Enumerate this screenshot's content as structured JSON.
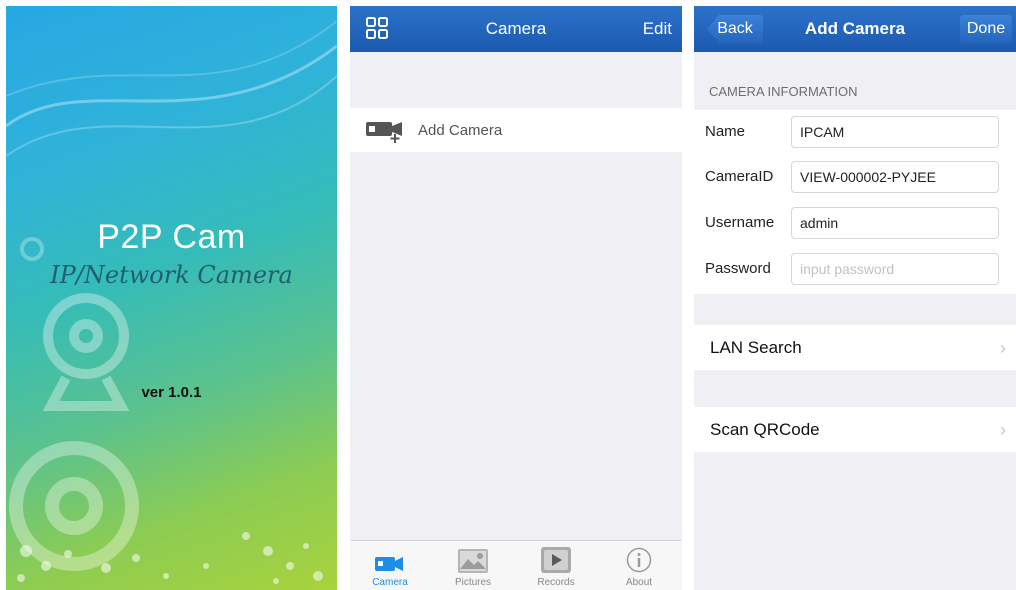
{
  "splash": {
    "title": "P2P Cam",
    "subtitle": "IP/Network Camera",
    "version": "ver 1.0.1"
  },
  "camera_list": {
    "nav_title": "Camera",
    "nav_right": "Edit",
    "menu_icon": "grid-icon",
    "add_camera_label": "Add Camera",
    "add_camera_icon": "camera-add-icon",
    "tabs": [
      {
        "label": "Camera",
        "icon": "camera-icon",
        "active": true
      },
      {
        "label": "Pictures",
        "icon": "pictures-icon",
        "active": false
      },
      {
        "label": "Records",
        "icon": "records-icon",
        "active": false
      },
      {
        "label": "About",
        "icon": "info-icon",
        "active": false
      }
    ]
  },
  "add_camera": {
    "back_label": "Back",
    "title": "Add Camera",
    "done_label": "Done",
    "section_header": "CAMERA INFORMATION",
    "fields": [
      {
        "label": "Name",
        "value": "IPCAM",
        "placeholder": ""
      },
      {
        "label": "CameraID",
        "value": "VIEW-000002-PYJEE",
        "placeholder": ""
      },
      {
        "label": "Username",
        "value": "admin",
        "placeholder": ""
      },
      {
        "label": "Password",
        "value": "",
        "placeholder": "input password"
      }
    ],
    "lan_search_label": "LAN Search",
    "scan_qrcode_label": "Scan QRCode"
  },
  "colors": {
    "nav_blue": "#1c5ab0",
    "tab_active": "#1d8de8",
    "splash_top": "#27a7e3",
    "splash_bottom": "#a8d23d"
  }
}
